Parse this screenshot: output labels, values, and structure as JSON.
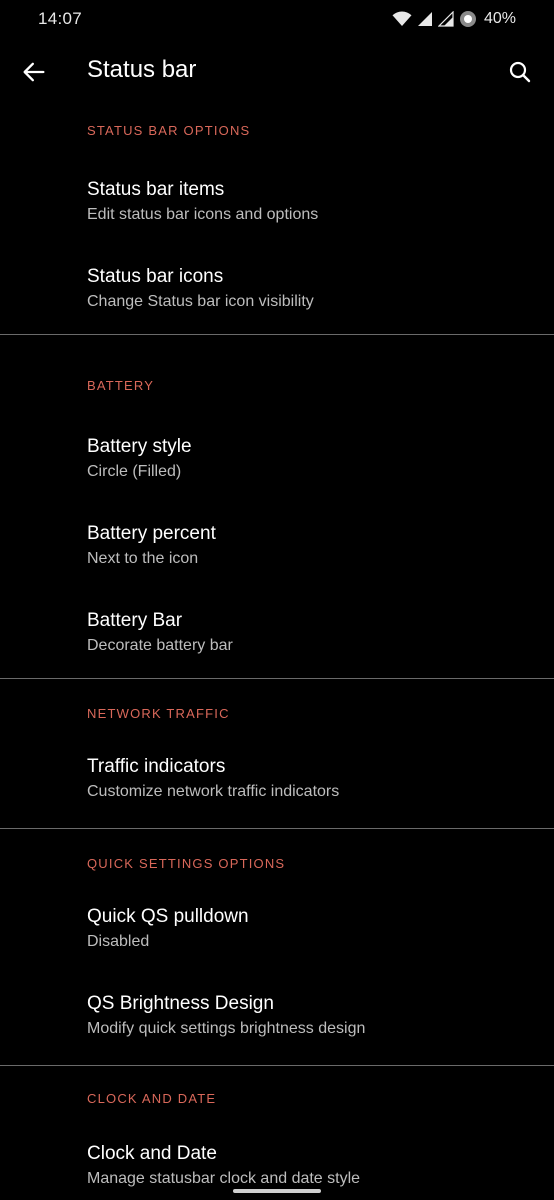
{
  "status_bar": {
    "time": "14:07",
    "battery_percent": "40%",
    "icons": [
      "wifi-icon",
      "signal-icon",
      "signal-icon",
      "battery-circle-icon"
    ]
  },
  "app_bar": {
    "title": "Status bar",
    "back_icon": "arrow-left-icon",
    "search_icon": "search-icon"
  },
  "colors": {
    "background": "#000000",
    "section_accent": "#d9685a",
    "title_text": "#ffffff",
    "summary_text": "#bdbdbd",
    "divider": "#6a6a6a"
  },
  "sections": [
    {
      "header": "STATUS BAR OPTIONS",
      "items": [
        {
          "title": "Status bar items",
          "summary": "Edit status bar icons and options"
        },
        {
          "title": "Status bar icons",
          "summary": "Change Status bar icon visibility"
        }
      ]
    },
    {
      "header": "BATTERY",
      "items": [
        {
          "title": "Battery style",
          "summary": "Circle (Filled)"
        },
        {
          "title": "Battery percent",
          "summary": "Next to the icon"
        },
        {
          "title": "Battery Bar",
          "summary": "Decorate battery bar"
        }
      ]
    },
    {
      "header": "NETWORK TRAFFIC",
      "items": [
        {
          "title": "Traffic indicators",
          "summary": "Customize network traffic indicators"
        }
      ]
    },
    {
      "header": "QUICK SETTINGS OPTIONS",
      "items": [
        {
          "title": "Quick QS pulldown",
          "summary": "Disabled"
        },
        {
          "title": "QS Brightness Design",
          "summary": "Modify quick settings brightness design"
        }
      ]
    },
    {
      "header": "CLOCK AND DATE",
      "items": [
        {
          "title": "Clock and Date",
          "summary": "Manage statusbar clock and date style"
        }
      ]
    }
  ]
}
